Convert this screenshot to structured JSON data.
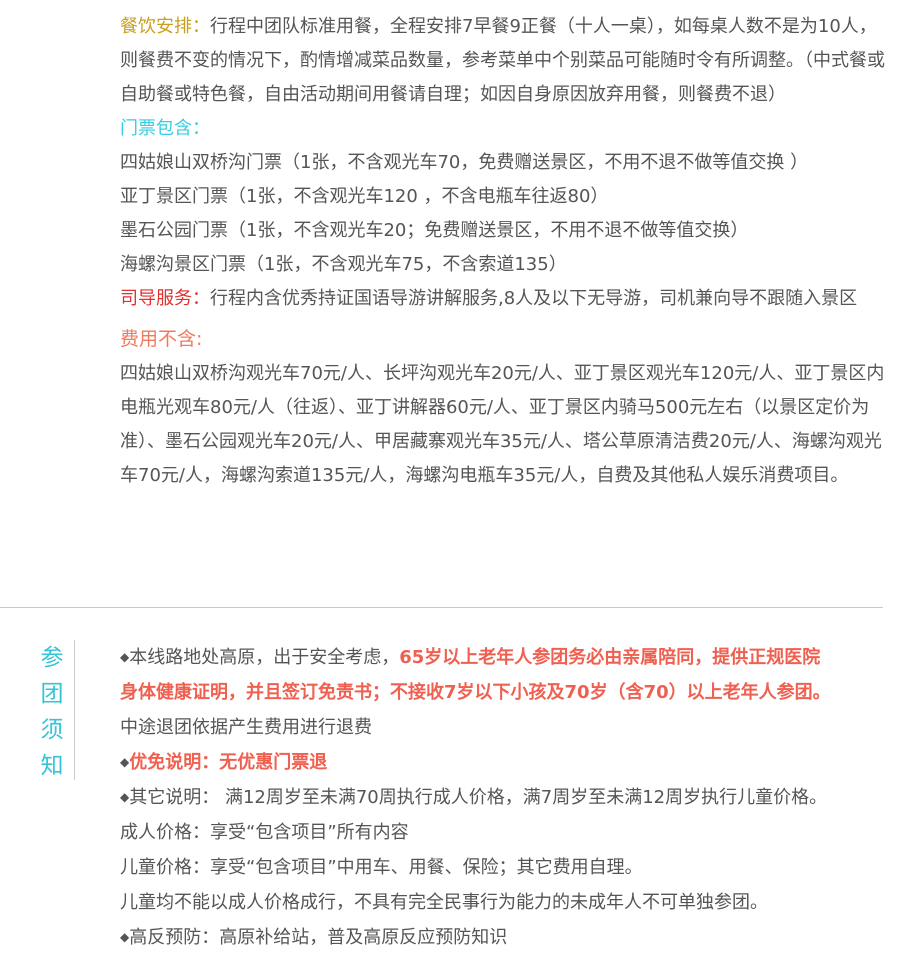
{
  "inclusions": {
    "dining": {
      "label": "餐饮安排：",
      "text": "行程中团队标准用餐，全程安排7早餐9正餐（十人一桌），如每桌人数不是为10人，则餐费不变的情况下，酌情增减菜品数量，参考菜单中个别菜品可能随时令有所调整。（中式餐或自助餐或特色餐，自由活动期间用餐请自理；如因自身原因放弃用餐，则餐费不退）"
    },
    "tickets": {
      "label": "门票包含：",
      "items": [
        "四姑娘山双桥沟门票（1张，不含观光车70，免费赠送景区，不用不退不做等值交换 ）",
        "亚丁景区门票（1张，不含观光车120 ，不含电瓶车往返80）",
        "墨石公园门票（1张，不含观光车20；免费赠送景区，不用不退不做等值交换）",
        "海螺沟景区门票（1张，不含观光车75，不含索道135）"
      ]
    },
    "guide": {
      "label": "司导服务：",
      "text": "行程内含优秀持证国语导游讲解服务,8人及以下无导游，司机兼向导不跟随入景区"
    }
  },
  "exclusions": {
    "label": "费用不含:",
    "text": "四姑娘山双桥沟观光车70元/人、长坪沟观光车20元/人、亚丁景区观光车120元/人、亚丁景区内电瓶光观车80元/人（往返）、亚丁讲解器60元/人、亚丁景区内骑马500元左右（以景区定价为准）、墨石公园观光车20元/人、甲居藏寨观光车35元/人、塔公草原清洁费20元/人、海螺沟观光车70元/人，海螺沟索道135元/人，海螺沟电瓶车35元/人，自费及其他私人娱乐消费项目。"
  },
  "notice": {
    "title_chars": [
      "参",
      "团",
      "须",
      "知"
    ],
    "bullet": "◆",
    "line1_prefix": "本线路地处高原，出于安全考虑，",
    "line1_highlight": "65岁以上老年人参团务必由亲属陪同，提供正规医院",
    "line2_highlight": "身体健康证明，并且签订免责书；不接收7岁以下小孩及70岁（含70）以上老年人参团。",
    "line3": "中途退团依据产生费用进行退费",
    "line4_highlight": "优免说明：无优惠门票退",
    "line5": "其它说明： 满12周岁至未满70周执行成人价格，满7周岁至未满12周岁执行儿童价格。",
    "line6": "成人价格：享受“包含项目”所有内容",
    "line7": "儿童价格：享受“包含项目”中用车、用餐、保险；其它费用自理。",
    "line8": "儿童均不能以成人价格成行，不具有完全民事行为能力的未成年人不可单独参团。",
    "line9": "高反预防：高原补给站，普及高原反应预防知识"
  }
}
